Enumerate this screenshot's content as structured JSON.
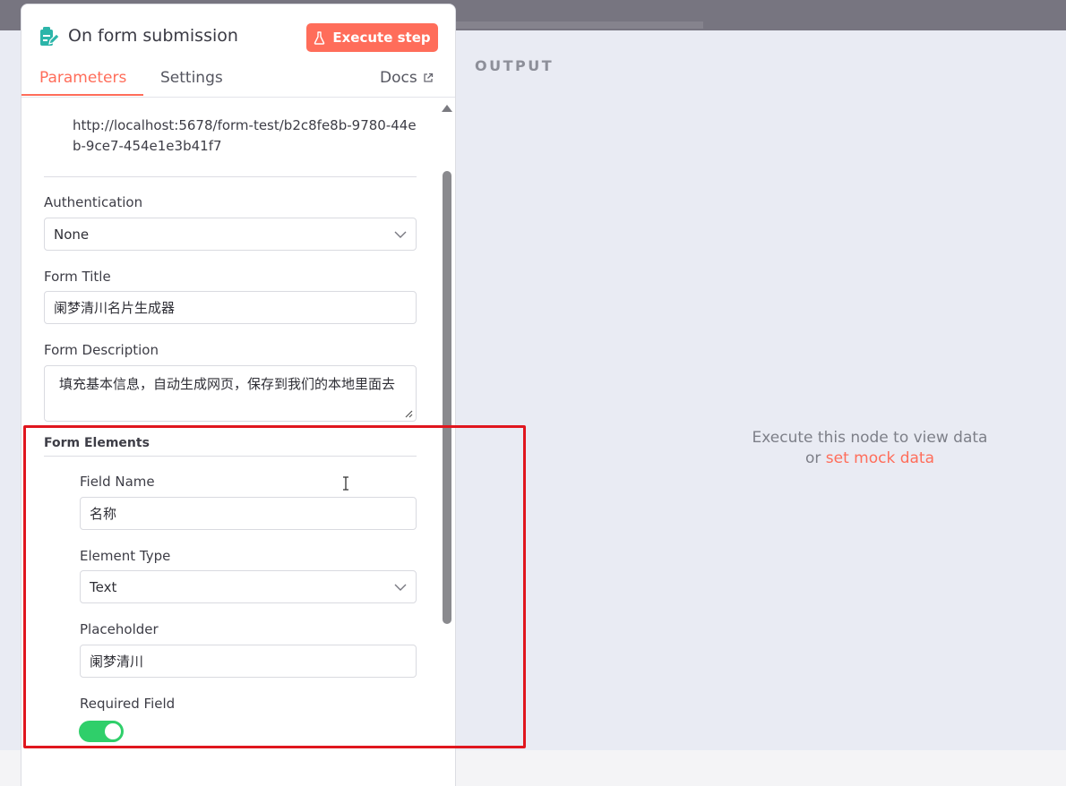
{
  "node": {
    "title": "On form submission",
    "icon": "form-edit-icon",
    "execute_label": "Execute step"
  },
  "tabs": [
    {
      "label": "Parameters",
      "active": true
    },
    {
      "label": "Settings",
      "active": false
    }
  ],
  "docs_label": "Docs",
  "form_url": "http://localhost:5678/form-test/b2c8fe8b-9780-44eb-9ce7-454e1e3b41f7",
  "authentication": {
    "label": "Authentication",
    "value": "None"
  },
  "form_title": {
    "label": "Form Title",
    "value": "阑梦清川名片生成器"
  },
  "form_description": {
    "label": "Form Description",
    "value": "填充基本信息，自动生成网页，保存到我们的本地里面去"
  },
  "form_elements": {
    "heading": "Form Elements",
    "field_name": {
      "label": "Field Name",
      "value": "名称"
    },
    "element_type": {
      "label": "Element Type",
      "value": "Text"
    },
    "placeholder": {
      "label": "Placeholder",
      "value": "阑梦清川"
    },
    "required": {
      "label": "Required Field",
      "on": true
    }
  },
  "output": {
    "title": "OUTPUT",
    "empty_line1": "Execute this node to view data",
    "empty_or": "or",
    "mock_link": "set mock data"
  },
  "colors": {
    "accent": "#ff6d5a",
    "toggle_on": "#2fcf6a",
    "highlight": "#e0161e",
    "icon_teal": "#2cb5a9"
  }
}
